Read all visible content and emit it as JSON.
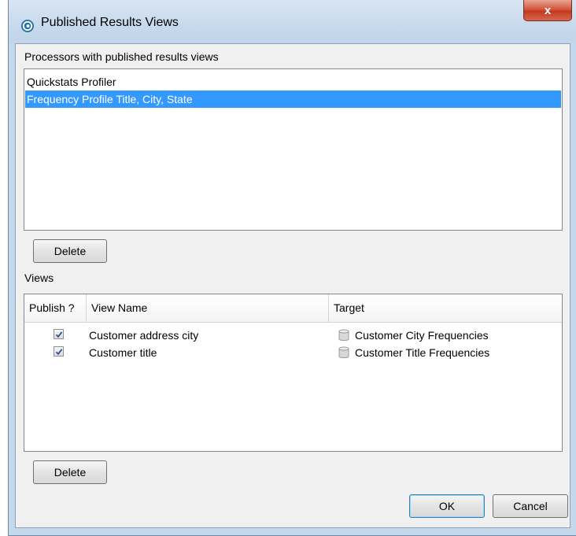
{
  "window": {
    "title": "Published Results Views",
    "close_glyph": "x"
  },
  "processors": {
    "label": "Processors with published results views",
    "items": [
      {
        "label": "Quickstats Profiler",
        "selected": false
      },
      {
        "label": "Frequency Profile Title, City, State",
        "selected": true
      }
    ],
    "delete_label": "Delete"
  },
  "views": {
    "label": "Views",
    "columns": [
      "Publish ?",
      "View Name",
      "Target"
    ],
    "rows": [
      {
        "publish": true,
        "view_name": "Customer address city",
        "target": "Customer City Frequencies",
        "target_icon": "database-icon"
      },
      {
        "publish": true,
        "view_name": "Customer title",
        "target": "Customer Title Frequencies",
        "target_icon": "database-icon"
      }
    ],
    "delete_label": "Delete"
  },
  "footer": {
    "ok_label": "OK",
    "cancel_label": "Cancel"
  },
  "colors": {
    "selection": "#3399ff",
    "close_button": "#c94a30"
  }
}
